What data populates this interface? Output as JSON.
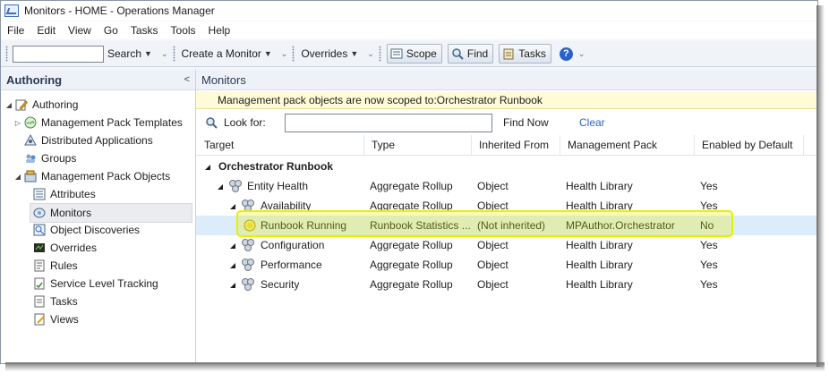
{
  "window": {
    "title": "Monitors - HOME - Operations Manager"
  },
  "menu": [
    "File",
    "Edit",
    "View",
    "Go",
    "Tasks",
    "Tools",
    "Help"
  ],
  "toolbar": {
    "search_label": "Search",
    "create_monitor_label": "Create a Monitor",
    "overrides_label": "Overrides",
    "scope_label": "Scope",
    "find_label": "Find",
    "tasks_label": "Tasks",
    "help_glyph": "?"
  },
  "left": {
    "header": "Authoring",
    "collapse_glyph": "<",
    "items": [
      {
        "label": "Authoring",
        "icon": "authoring-icon"
      },
      {
        "label": "Management Pack Templates",
        "icon": "template-icon"
      },
      {
        "label": "Distributed Applications",
        "icon": "distributed-app-icon"
      },
      {
        "label": "Groups",
        "icon": "groups-icon"
      },
      {
        "label": "Management Pack Objects",
        "icon": "mp-objects-icon"
      },
      {
        "label": "Attributes",
        "icon": "attributes-icon"
      },
      {
        "label": "Monitors",
        "icon": "monitors-icon"
      },
      {
        "label": "Object Discoveries",
        "icon": "discoveries-icon"
      },
      {
        "label": "Overrides",
        "icon": "overrides-icon"
      },
      {
        "label": "Rules",
        "icon": "rules-icon"
      },
      {
        "label": "Service Level Tracking",
        "icon": "sla-icon"
      },
      {
        "label": "Tasks",
        "icon": "tasks-icon"
      },
      {
        "label": "Views",
        "icon": "views-icon"
      }
    ]
  },
  "right": {
    "header": "Monitors",
    "info": "Management pack objects are now scoped to:Orchestrator Runbook",
    "look_for_label": "Look for:",
    "find_now_label": "Find Now",
    "clear_label": "Clear",
    "columns": [
      "Target",
      "Type",
      "Inherited From",
      "Management Pack",
      "Enabled by Default"
    ],
    "group": "Orchestrator Runbook",
    "rows": [
      {
        "target": "Entity Health",
        "type": "Aggregate Rollup",
        "inherited": "Object",
        "mp": "Health Library",
        "enabled": "Yes"
      },
      {
        "target": "Availability",
        "type": "Aggregate Rollup",
        "inherited": "Object",
        "mp": "Health Library",
        "enabled": "Yes"
      },
      {
        "target": "Runbook Running",
        "type": "Runbook Statistics ...",
        "inherited": "(Not inherited)",
        "mp": "MPAuthor.Orchestrator",
        "enabled": "No"
      },
      {
        "target": "Configuration",
        "type": "Aggregate Rollup",
        "inherited": "Object",
        "mp": "Health Library",
        "enabled": "Yes"
      },
      {
        "target": "Performance",
        "type": "Aggregate Rollup",
        "inherited": "Object",
        "mp": "Health Library",
        "enabled": "Yes"
      },
      {
        "target": "Security",
        "type": "Aggregate Rollup",
        "inherited": "Object",
        "mp": "Health Library",
        "enabled": "Yes"
      }
    ]
  },
  "colors": {
    "accent": "#2a62c9",
    "info_bar": "#fffbd6",
    "highlight": "#e6f000",
    "selected_row": "#ddecfa"
  }
}
